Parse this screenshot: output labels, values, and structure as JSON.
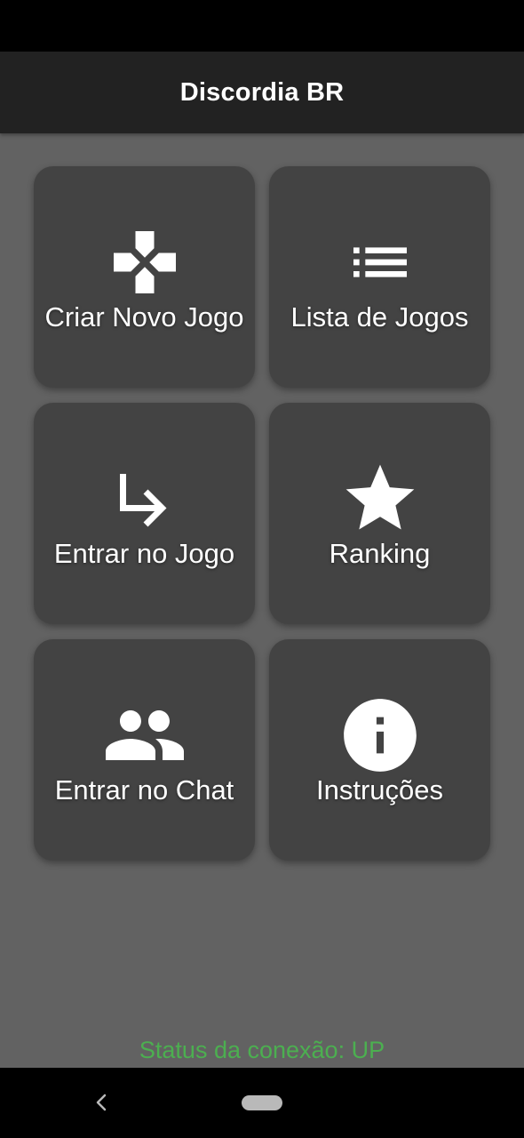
{
  "app": {
    "title": "Discordia BR"
  },
  "menu": {
    "items": [
      {
        "label": "Criar Novo Jogo",
        "icon": "gamepad-icon"
      },
      {
        "label": "Lista de Jogos",
        "icon": "list-icon"
      },
      {
        "label": "Entrar no Jogo",
        "icon": "subdirectory-arrow-right-icon"
      },
      {
        "label": "Ranking",
        "icon": "star-icon"
      },
      {
        "label": "Entrar no Chat",
        "icon": "people-icon"
      },
      {
        "label": "Instruções",
        "icon": "info-icon"
      }
    ]
  },
  "status": {
    "text": "Status da conexão: UP",
    "color": "#4caf50"
  },
  "navigation": {
    "back_icon": "chevron-left-icon",
    "home_icon": "home-pill-icon"
  },
  "colors": {
    "background": "#626262",
    "app_bar": "#222222",
    "tile": "#434343",
    "text": "#ffffff"
  }
}
